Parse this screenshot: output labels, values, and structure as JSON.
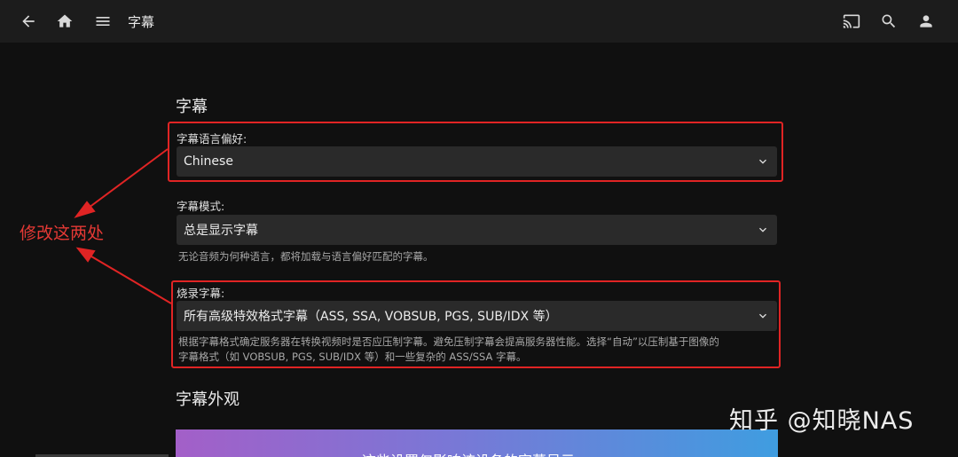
{
  "header": {
    "title": "字幕",
    "icons": [
      "back-arrow-icon",
      "home-icon",
      "menu-icon",
      "cast-icon",
      "search-icon",
      "user-icon"
    ]
  },
  "main": {
    "section_subtitles": "字幕",
    "language_pref": {
      "label": "字幕语言偏好:",
      "value": "Chinese"
    },
    "subtitle_mode": {
      "label": "字幕模式:",
      "value": "总是显示字幕",
      "help": "无论音频为何种语言，都将加载与语言偏好匹配的字幕。"
    },
    "burn_in": {
      "label": "烧录字幕:",
      "value": "所有高级特效格式字幕（ASS, SSA, VOBSUB, PGS, SUB/IDX 等）",
      "help_line1": "根据字幕格式确定服务器在转换视频时是否应压制字幕。避免压制字幕会提高服务器性能。选择“自动”以压制基于图像的",
      "help_line2": "字幕格式（如 VOBSUB, PGS, SUB/IDX 等）和一些复杂的 ASS/SSA 字幕。"
    },
    "section_appearance": "字幕外观",
    "banner_text": "这些设置仅影响该设备的字幕显示"
  },
  "annotation": {
    "text": "修改这两处",
    "color": "#e53935"
  },
  "watermark": "知乎 @知晓NAS",
  "colors": {
    "background": "#101010",
    "topbar": "#1c1c1c",
    "select_bg": "#2a2a2a",
    "highlight_box": "#e02424"
  }
}
